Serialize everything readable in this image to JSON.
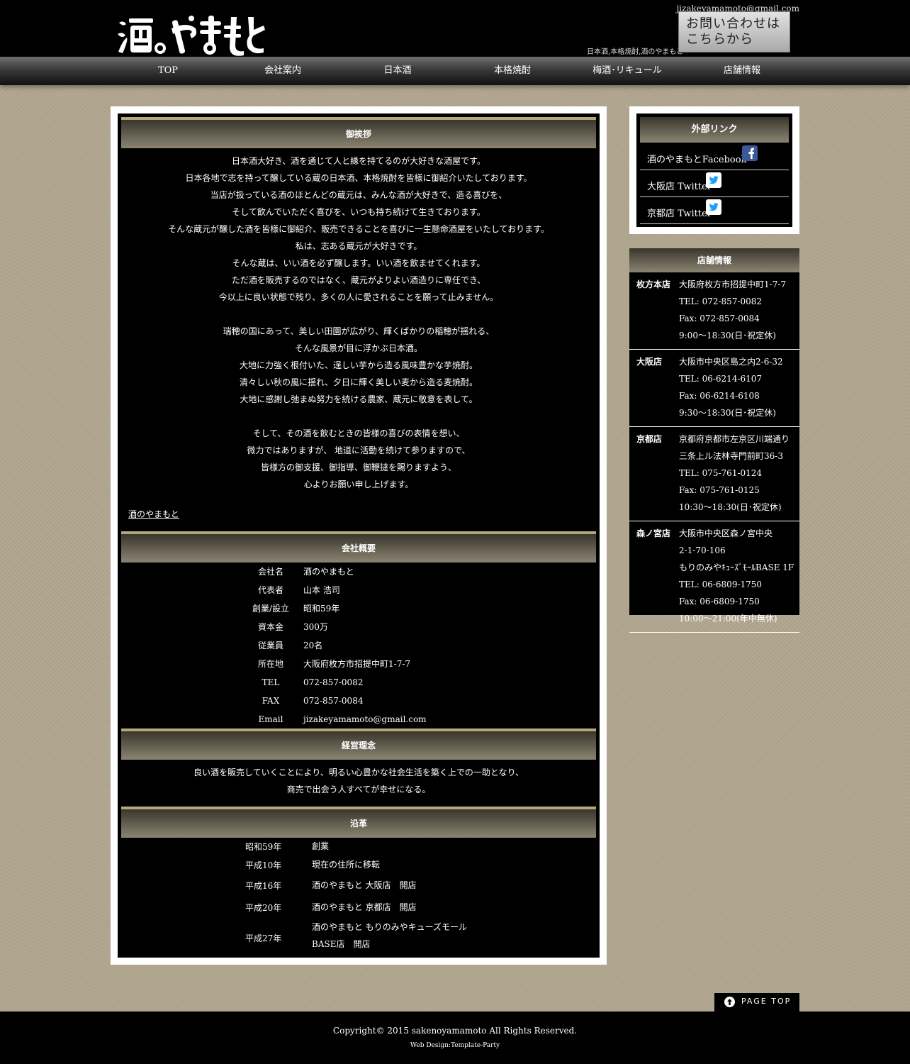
{
  "header": {
    "logo_text": "酒のやまもと",
    "email": "jizakeyamamoto@gmail.com",
    "tagline": "日本酒,本格焼酎,酒のやまもと",
    "contact_line1": "お問い合わせは",
    "contact_line2": "こちらから"
  },
  "nav": [
    "TOP",
    "会社案内",
    "日本酒",
    "本格焼酎",
    "梅酒･リキュール",
    "店舗情報"
  ],
  "greeting": {
    "title": "御挨拶",
    "lines": [
      "日本酒大好き、酒を通じて人と縁を持てるのが大好きな酒屋です。",
      "日本各地で志を持って醸している蔵の日本酒、本格焼酎を皆様に御紹介いたしております。",
      "当店が扱っている酒のほとんどの蔵元は、みんな酒が大好きで、造る喜びを、",
      "そして飲んでいただく喜びを、いつも持ち続けて生きております。",
      "そんな蔵元が醸した酒を皆様に御紹介、販売できることを喜びに一生懸命酒屋をいたしております。",
      "私は、志ある蔵元が大好きです。",
      "そんな蔵は、いい酒を必ず醸します。いい酒を飲ませてくれます。",
      "ただ酒を販売するのではなく、蔵元がよりよい酒造りに専任でき、",
      "今以上に良い状態で残り、多くの人に愛されることを願って止みません。",
      "",
      "瑞穂の国にあって、美しい田園が広がり、輝くばかりの稲穂が揺れる、",
      "そんな風景が目に浮かぶ日本酒。",
      "大地に力強く根付いた、逞しい芋から造る風味豊かな芋焼酎。",
      "清々しい秋の風に揺れ、夕日に輝く美しい麦から造る麦焼酎。",
      "大地に感謝し弛まぬ努力を続ける農家、蔵元に敬意を表して。",
      "",
      "そして、その酒を飲むときの皆様の喜びの表情を想い、",
      "微力ではありますが、 地道に活動を続けて参りますので、",
      "皆様方の御支援、御指導、御鞭撻を賜りますよう、",
      "心よりお願い申し上げます。"
    ],
    "signature": "酒のやまもと"
  },
  "company": {
    "title": "会社概要",
    "rows": [
      {
        "k": "会社名",
        "v": "酒のやまもと"
      },
      {
        "k": "代表者",
        "v": "山本 浩司"
      },
      {
        "k": "創業/設立",
        "v": "昭和59年"
      },
      {
        "k": "資本金",
        "v": "300万"
      },
      {
        "k": "従業員",
        "v": "20名"
      },
      {
        "k": "所在地",
        "v": "大阪府枚方市招提中町1-7-7"
      },
      {
        "k": "TEL",
        "v": "072-857-0082"
      },
      {
        "k": "FAX",
        "v": "072-857-0084"
      },
      {
        "k": "Email",
        "v": "jizakeyamamoto@gmail.com"
      }
    ]
  },
  "philosophy": {
    "title": "経営理念",
    "lines": [
      "良い酒を販売していくことにより、明るい心豊かな社会生活を築く上での一助となり、",
      "商売で出会う人すべてが幸せになる。"
    ]
  },
  "history": {
    "title": "沿革",
    "rows": [
      {
        "k": "昭和59年",
        "v1": "創業",
        "v2": ""
      },
      {
        "k": "平成10年",
        "v1": "現在の住所に移転",
        "v2": ""
      },
      {
        "k": "平成16年",
        "v1": "酒のやまもと 大阪店　開店",
        "v2": ""
      },
      {
        "k": "平成20年",
        "v1": "酒のやまもと 京都店　開店",
        "v2": ""
      },
      {
        "k": "平成27年",
        "v1": "酒のやまもと もりのみやキューズモール",
        "v2": "BASE店　開店"
      }
    ]
  },
  "links": {
    "title": "外部リンク",
    "items": [
      {
        "label": "酒のやまもとFacebook",
        "icon": "facebook-icon"
      },
      {
        "label": "大阪店 Twitter",
        "icon": "twitter-icon"
      },
      {
        "label": "京都店 Twitter",
        "icon": "twitter-icon"
      }
    ]
  },
  "shops": {
    "title": "店舗情報",
    "items": [
      {
        "name": "枚方本店",
        "lines": [
          "大阪府枚方市招提中町1-7-7",
          "TEL: 072-857-0082",
          "Fax: 072-857-0084",
          "9:00～18:30(日･祝定休)"
        ]
      },
      {
        "name": "大阪店",
        "lines": [
          "大阪市中央区島之内2-6-32",
          "TEL: 06-6214-6107",
          "Fax: 06-6214-6108",
          "9:30～18:30(日･祝定休)"
        ]
      },
      {
        "name": "京都店",
        "lines": [
          "京都府京都市左京区川端通り",
          "三条上ル法林寺門前町36-3",
          "TEL: 075-761-0124",
          "Fax: 075-761-0125",
          "10:30～18:30(日･祝定休)"
        ]
      },
      {
        "name": "森ノ宮店",
        "lines": [
          "大阪市中央区森ノ宮中央",
          "2-1-70-106",
          "もりのみやｷｭｰｽﾞﾓｰﾙBASE 1F",
          "TEL: 06-6809-1750",
          "Fax: 06-6809-1750",
          "10:00～21:00(年中無休)"
        ]
      }
    ]
  },
  "pagetop": "PAGE TOP",
  "footer": {
    "copyright": "Copyright© 2015 sakenoyamamoto All Rights Reserved.",
    "design": "Web Design:Template-Party"
  },
  "colors": {
    "page_bg": "#b0a68f",
    "header_bg": "#000000",
    "section_head_top": "#3a362c",
    "section_head_bottom": "#8b8472",
    "accent_gold": "#b3a878"
  }
}
